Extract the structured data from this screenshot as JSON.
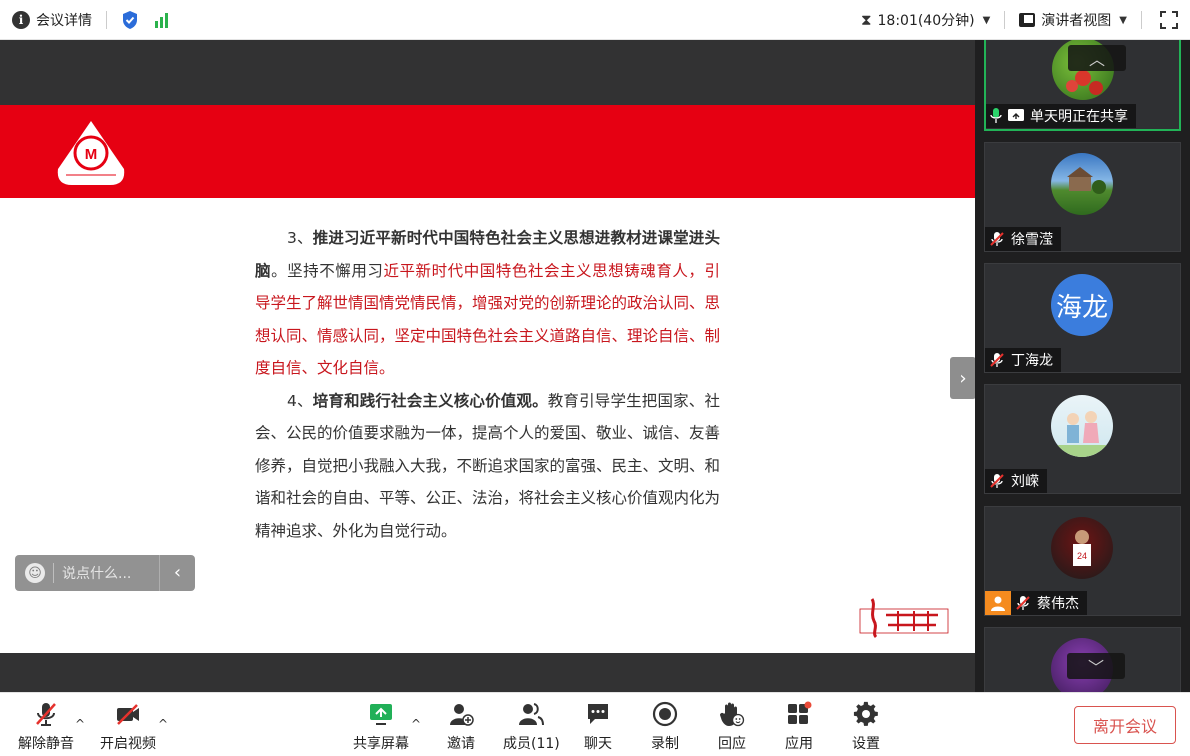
{
  "topbar": {
    "meeting_details": "会议详情",
    "time": "18:01(40分钟)",
    "view_mode": "演讲者视图"
  },
  "slide": {
    "para3_num": "3、",
    "para3_bold": "推进习近平新时代中国特色社会主义思想进教材进课堂进头脑",
    "para3_mid": "。坚持不懈用习",
    "para3_red": "近平新时代中国特色社会主义思想铸魂育人，引导学生了解世情国情党情民情，增强对党的创新理论的政治认同、思想认同、情感认同，坚定中国特色社会主义道路自信、理论自信、制度自信、文化自信。",
    "para4_num": "4、",
    "para4_bold": "培育和践行社会主义核心价值观。",
    "para4_rest": "教育引导学生把国家、社会、公民的价值要求融为一体，提高个人的爱国、敬业、诚信、友善修养，自觉把小我融入大我，不断追求国家的富强、民主、文明、和谐和社会的自由、平等、公正、法治，将社会主义核心价值观内化为精神追求、外化为自觉行动。",
    "logo_text": "中国医科大学",
    "sign_text": "红医摇篮"
  },
  "chat": {
    "placeholder": "说点什么..."
  },
  "participants": [
    {
      "name": "单天明正在共享",
      "status": "sharing"
    },
    {
      "name": "徐雪滢",
      "status": "muted"
    },
    {
      "name": "丁海龙",
      "status": "muted",
      "avatar_text": "海龙"
    },
    {
      "name": "刘嵘",
      "status": "muted"
    },
    {
      "name": "蔡伟杰",
      "status": "muted"
    },
    {
      "name": "",
      "status": "partial"
    }
  ],
  "toolbar": {
    "unmute": "解除静音",
    "start_video": "开启视频",
    "share_screen": "共享屏幕",
    "invite": "邀请",
    "members": "成员(11)",
    "chat": "聊天",
    "record": "录制",
    "react": "回应",
    "apps": "应用",
    "settings": "设置",
    "leave": "离开会议"
  },
  "colors": {
    "banner_red": "#e60012",
    "active_green": "#22b357",
    "leave_red": "#d9534f",
    "shield_blue": "#2b6cd9"
  }
}
